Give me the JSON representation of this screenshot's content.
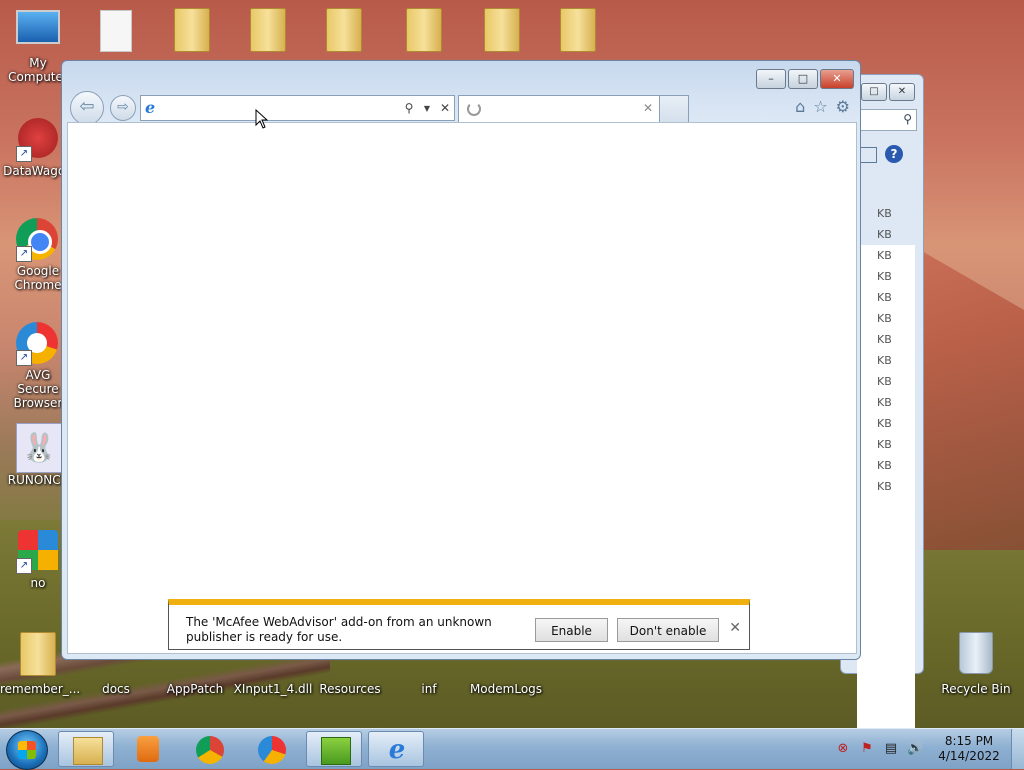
{
  "desktop": {
    "left_icons": [
      {
        "label": "My Computer"
      },
      {
        "label": "DataWagon"
      },
      {
        "label": "Google Chrome"
      },
      {
        "label": "AVG Secure Browser"
      },
      {
        "label": "RUNONCE"
      },
      {
        "label": "no"
      },
      {
        "label": "remember_..."
      }
    ],
    "bottom_icons": [
      {
        "label": "docs"
      },
      {
        "label": "AppPatch"
      },
      {
        "label": "XInput1_4.dll"
      },
      {
        "label": "Resources"
      },
      {
        "label": "inf"
      },
      {
        "label": "ModemLogs"
      }
    ],
    "recycle_bin": {
      "label": "Recycle Bin"
    }
  },
  "back_window": {
    "sizes": [
      "KB",
      "KB",
      "KB",
      "KB",
      "KB",
      "KB",
      "KB",
      "KB",
      "KB",
      "KB",
      "KB",
      "KB",
      "KB",
      "KB"
    ]
  },
  "ie": {
    "address_value": "",
    "tab_title": "",
    "window_controls": {
      "minimize": "–",
      "maximize": "□",
      "close": "✕"
    }
  },
  "notification": {
    "message": "The 'McAfee WebAdvisor' add-on from an unknown publisher is ready for use.",
    "enable_label": "Enable",
    "dont_enable_label": "Don't enable",
    "close_label": "✕"
  },
  "taskbar": {
    "time": "8:15 PM",
    "date": "4/14/2022"
  },
  "colors": {
    "notification_accent": "#f0b010",
    "ie_frame": "#c7d9ee"
  }
}
